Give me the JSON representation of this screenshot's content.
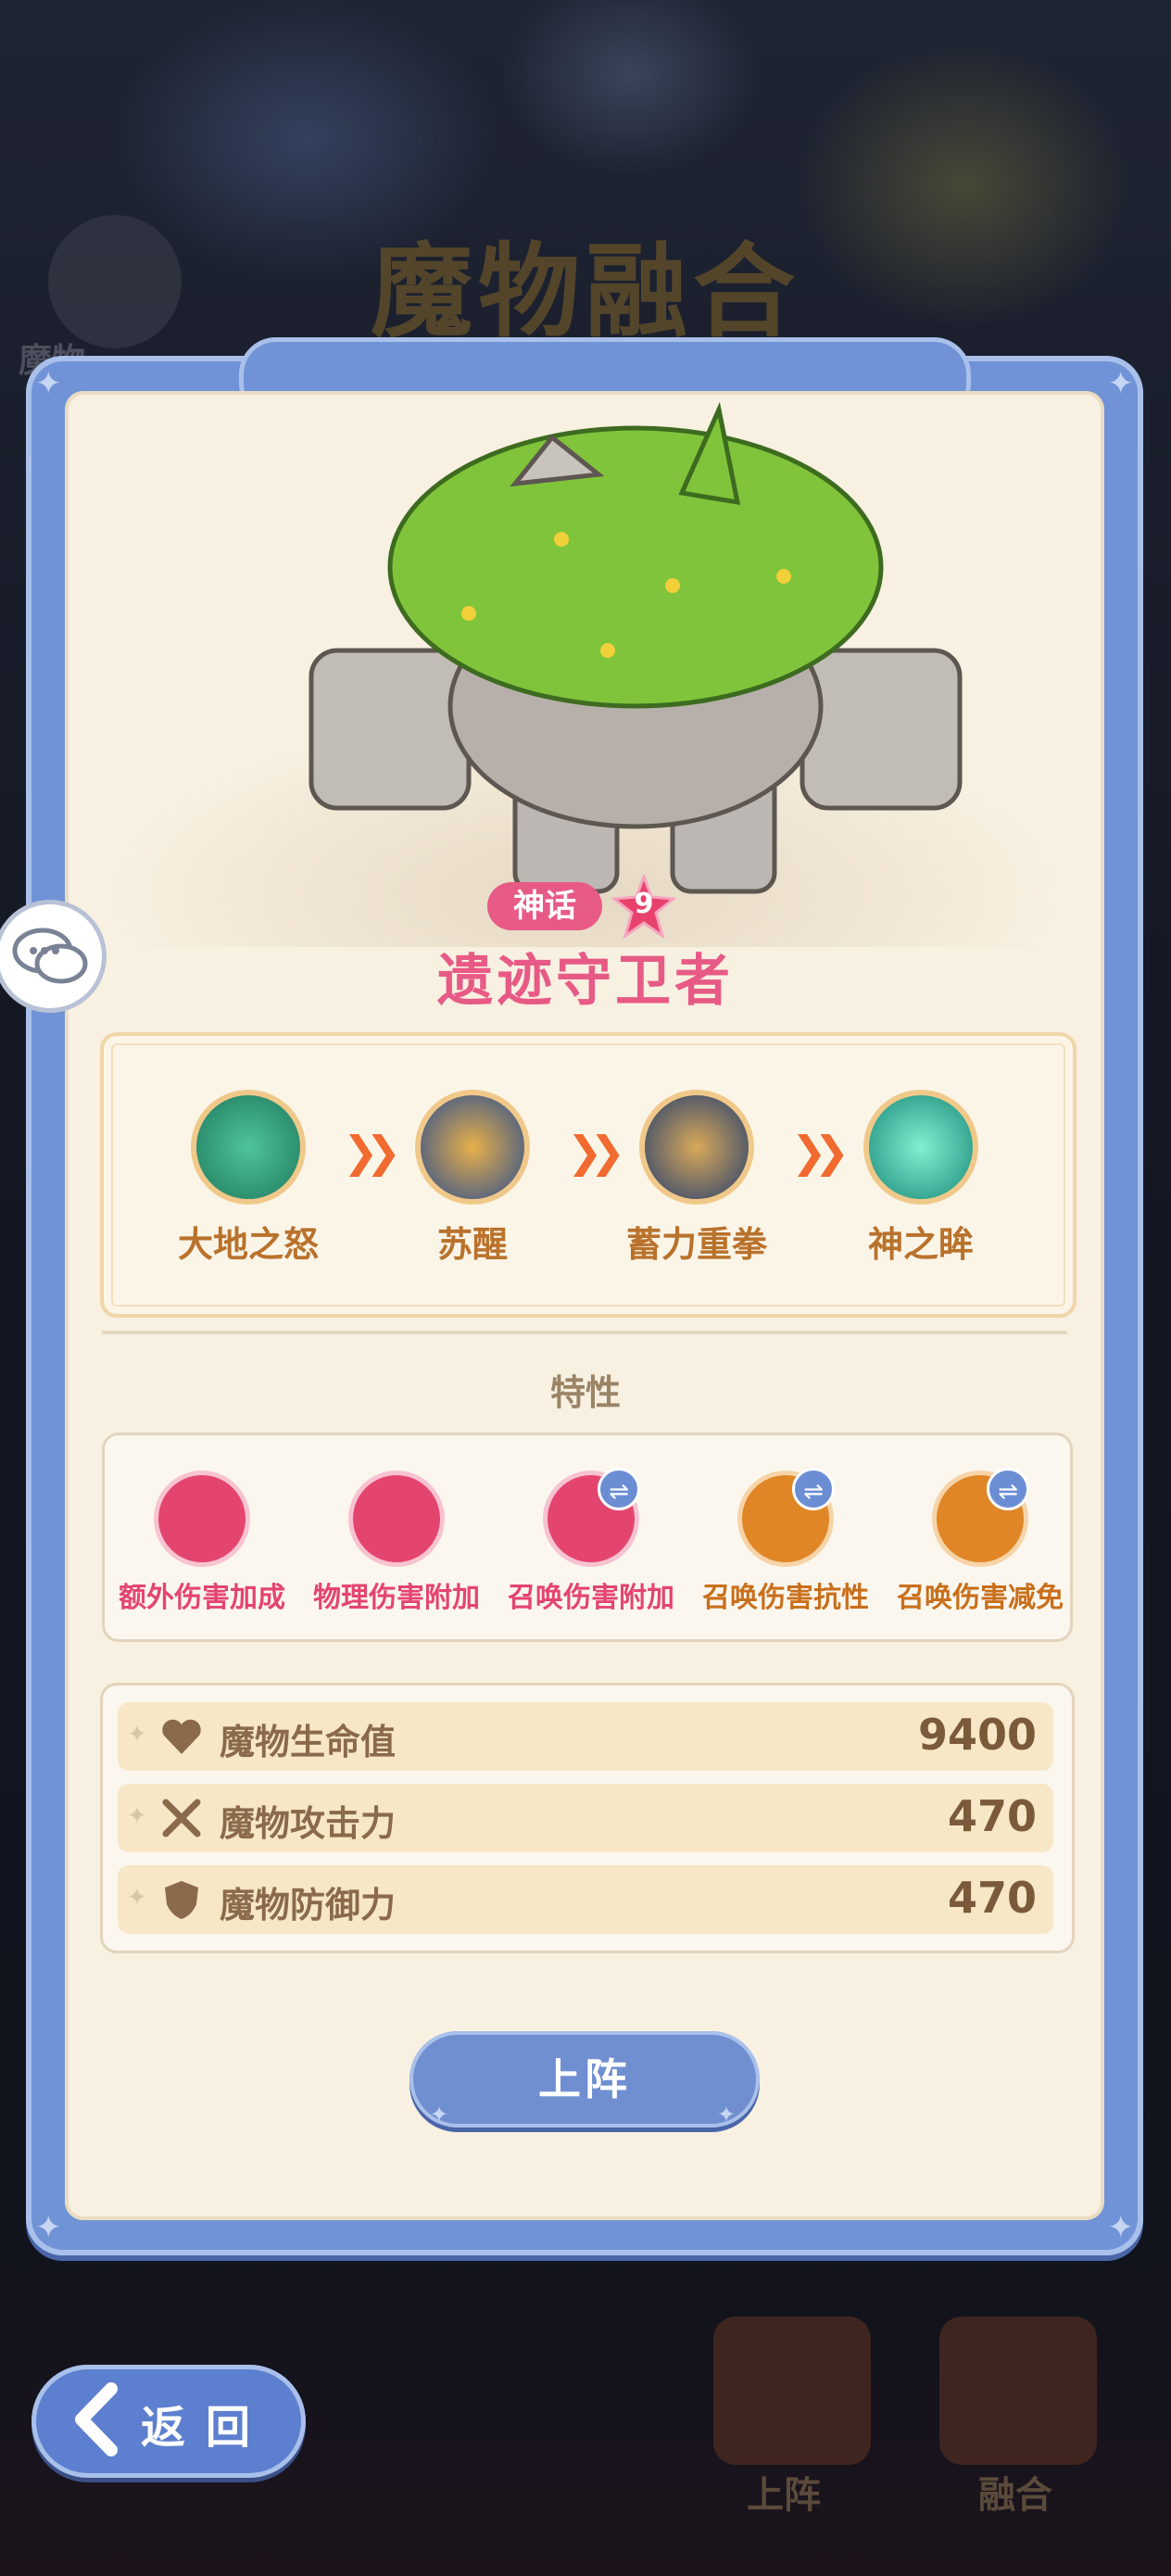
{
  "background": {
    "title": "魔物融合",
    "left_label": "魔物",
    "tabs": [
      {
        "label": "上阵"
      },
      {
        "label": "融合"
      }
    ]
  },
  "monster": {
    "rarity": "神话",
    "star_level": "9",
    "name": "遗迹守卫者"
  },
  "evolution": [
    {
      "label": "大地之怒",
      "icon": "earth-fury-icon",
      "color": "#1f7a5e"
    },
    {
      "label": "苏醒",
      "icon": "awaken-icon",
      "color": "#2a4d8f"
    },
    {
      "label": "蓄力重拳",
      "icon": "charged-punch-icon",
      "color": "#243e6e"
    },
    {
      "label": "神之眸",
      "icon": "divine-eye-icon",
      "color": "#1c8a79"
    }
  ],
  "traits_title": "特性",
  "traits": [
    {
      "label": "额外伤害加成",
      "color": "#e4456f",
      "swap": false
    },
    {
      "label": "物理伤害附加",
      "color": "#e4456f",
      "swap": false
    },
    {
      "label": "召唤伤害附加",
      "color": "#e4456f",
      "swap": true
    },
    {
      "label": "召唤伤害抗性",
      "color": "#e08627",
      "swap": true
    },
    {
      "label": "召唤伤害减免",
      "color": "#e08627",
      "swap": true
    }
  ],
  "stats": [
    {
      "label": "魔物生命值",
      "value": "9400",
      "icon": "heart-icon"
    },
    {
      "label": "魔物攻击力",
      "value": "470",
      "icon": "swords-icon"
    },
    {
      "label": "魔物防御力",
      "value": "470",
      "icon": "shield-icon"
    }
  ],
  "deploy_button": "上阵",
  "back_button": "返回",
  "colors": {
    "panel_blue": "#6f93d6",
    "name_pink": "#e85a86",
    "evo_label": "#b9722c"
  }
}
